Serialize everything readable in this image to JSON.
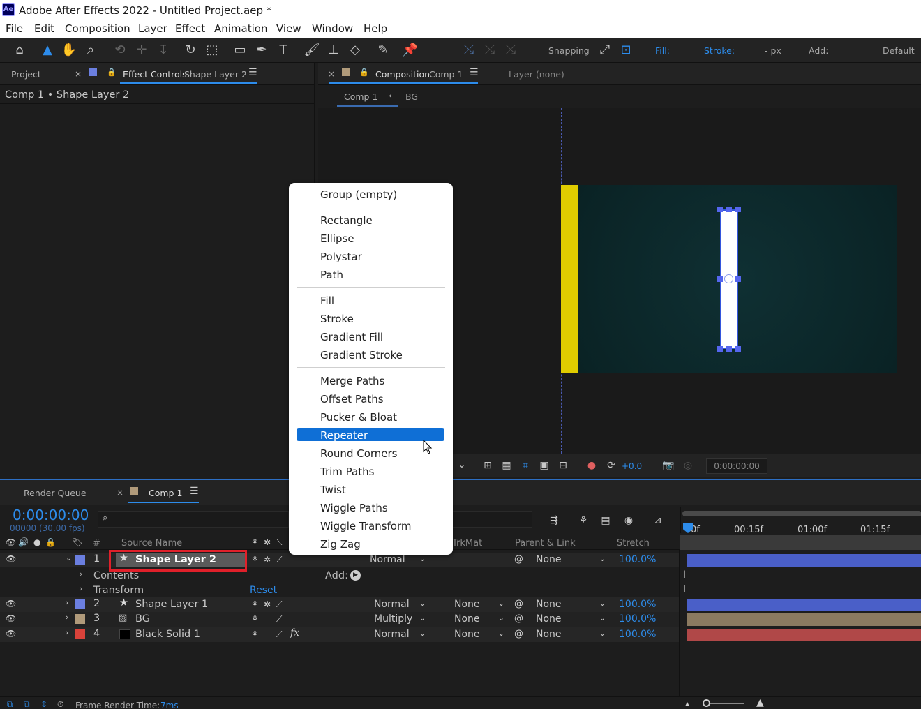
{
  "window": {
    "app_icon": "Ae",
    "title": "Adobe After Effects 2022 - Untitled Project.aep *"
  },
  "menu": [
    "File",
    "Edit",
    "Composition",
    "Layer",
    "Effect",
    "Animation",
    "View",
    "Window",
    "Help"
  ],
  "toolbar": {
    "snapping_label": "Snapping",
    "fill_label": "Fill:",
    "stroke_label": "Stroke:",
    "stroke_units": "- px",
    "add_label": "Add:",
    "workspace": "Default",
    "fill_color": "#ffffff",
    "accent": "#2d8ceb"
  },
  "left_panel": {
    "tab_project": "Project",
    "tab_effect_controls_prefix": "Effect Controls",
    "tab_effect_controls_layer": "Shape Layer 2",
    "breadcrumb": "Comp 1 • Shape Layer 2"
  },
  "comp_panel": {
    "tab_prefix": "Composition",
    "tab_comp": "Comp 1",
    "tab_layer": "Layer (none)",
    "flow_current": "Comp 1",
    "flow_prev": "BG",
    "exposure": "+0.0",
    "timecode": "0:00:00:00"
  },
  "context_menu": {
    "groups": [
      [
        "Group (empty)"
      ],
      [
        "Rectangle",
        "Ellipse",
        "Polystar",
        "Path"
      ],
      [
        "Fill",
        "Stroke",
        "Gradient Fill",
        "Gradient Stroke"
      ],
      [
        "Merge Paths",
        "Offset Paths",
        "Pucker & Bloat",
        "Repeater",
        "Round Corners",
        "Trim Paths",
        "Twist",
        "Wiggle Paths",
        "Wiggle Transform",
        "Zig Zag"
      ]
    ],
    "highlighted": "Repeater"
  },
  "timeline": {
    "tab_render_queue": "Render Queue",
    "tab_comp": "Comp 1",
    "timecode": "0:00:00:00",
    "frame_info": "00000 (30.00 fps)",
    "columns": {
      "num": "#",
      "source": "Source Name",
      "trkmat": "TrkMat",
      "parent": "Parent & Link",
      "stretch": "Stretch"
    },
    "ruler": [
      "0f",
      "00:15f",
      "01:00f",
      "01:15f"
    ],
    "layers": [
      {
        "num": "1",
        "name": "Shape Layer 2",
        "mode": "Normal",
        "trkmat": "",
        "parent": "None",
        "stretch": "100.0%",
        "label_color": "#6b7fe0",
        "bar_color": "#4a5fc8"
      },
      {
        "num": "2",
        "name": "Shape Layer 1",
        "mode": "Normal",
        "trkmat": "None",
        "parent": "None",
        "stretch": "100.0%",
        "label_color": "#6b7fe0",
        "bar_color": "#4a5fc8"
      },
      {
        "num": "3",
        "name": "BG",
        "mode": "Multiply",
        "trkmat": "None",
        "parent": "None",
        "stretch": "100.0%",
        "label_color": "#b09a7a",
        "bar_color": "#8b7a60"
      },
      {
        "num": "4",
        "name": "Black Solid 1",
        "mode": "Normal",
        "trkmat": "None",
        "parent": "None",
        "stretch": "100.0%",
        "label_color": "#d9423a",
        "bar_color": "#b04848"
      }
    ],
    "sub_contents": "Contents",
    "sub_transform": "Transform",
    "add_label": "Add:",
    "reset_label": "Reset",
    "footer_render_time_label": "Frame Render Time:",
    "footer_render_time_value": "7ms"
  }
}
